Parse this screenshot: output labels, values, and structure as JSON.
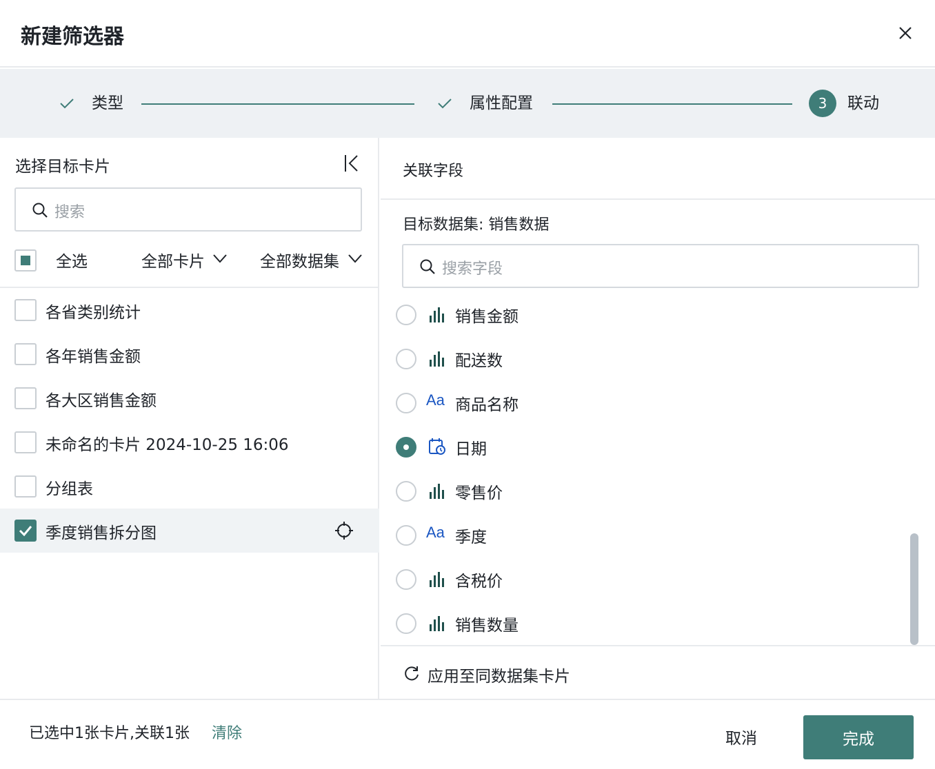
{
  "dialog": {
    "title": "新建筛选器",
    "close_icon": "close-icon"
  },
  "steps": [
    {
      "label": "类型",
      "status": "done"
    },
    {
      "label": "属性配置",
      "status": "done"
    },
    {
      "number": "3",
      "label": "联动",
      "status": "current"
    }
  ],
  "left_panel": {
    "title": "选择目标卡片",
    "search_placeholder": "搜索",
    "select_all": "全选",
    "filter_cards": "全部卡片",
    "filter_datasets": "全部数据集",
    "cards": [
      {
        "label": "各省类别统计",
        "checked": false
      },
      {
        "label": "各年销售金额",
        "checked": false
      },
      {
        "label": "各大区销售金额",
        "checked": false
      },
      {
        "label": "未命名的卡片 2024-10-25 16:06",
        "checked": false
      },
      {
        "label": "分组表",
        "checked": false
      },
      {
        "label": "季度销售拆分图",
        "checked": true
      }
    ]
  },
  "right_panel": {
    "title": "关联字段",
    "dataset_label": "目标数据集: 销售数据",
    "search_placeholder": "搜索字段",
    "type_text": "Aa",
    "fields": [
      {
        "label": "销售金额",
        "type": "measure",
        "selected": false
      },
      {
        "label": "配送数",
        "type": "measure",
        "selected": false
      },
      {
        "label": "商品名称",
        "type": "text",
        "selected": false
      },
      {
        "label": "日期",
        "type": "date",
        "selected": true
      },
      {
        "label": "零售价",
        "type": "measure",
        "selected": false
      },
      {
        "label": "季度",
        "type": "text",
        "selected": false
      },
      {
        "label": "含税价",
        "type": "measure",
        "selected": false
      },
      {
        "label": "销售数量",
        "type": "measure",
        "selected": false
      }
    ],
    "apply_label": "应用至同数据集卡片"
  },
  "footer": {
    "status": "已选中1张卡片,关联1张",
    "clear": "清除",
    "cancel": "取消",
    "done": "完成"
  },
  "colors": {
    "primary": "#3f7d78",
    "link_blue": "#1a56c2",
    "step_bg": "#eef1f4"
  }
}
